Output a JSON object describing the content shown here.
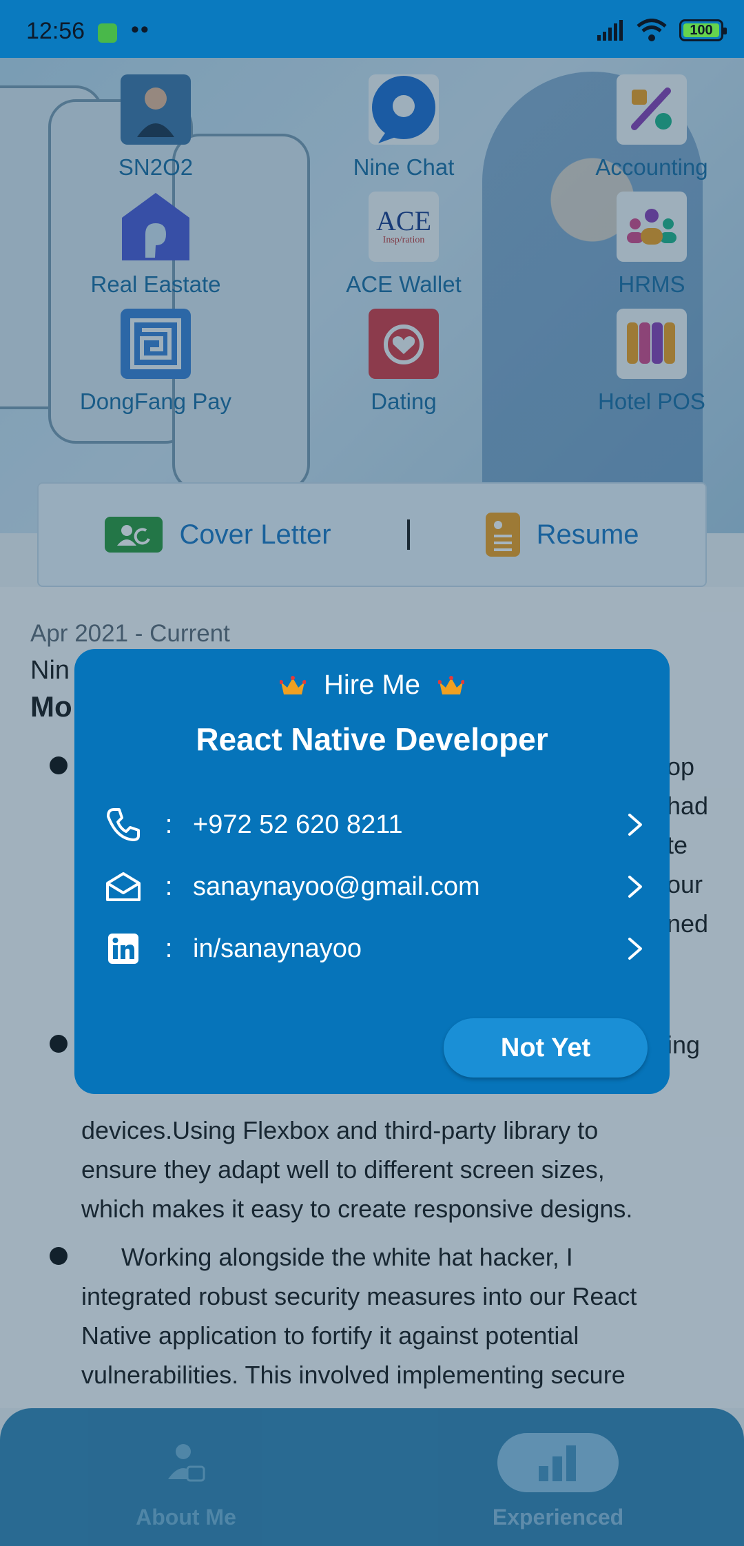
{
  "status_bar": {
    "time": "12:56",
    "battery": "100"
  },
  "apps": [
    {
      "label": "SN2O2",
      "icon": "person-photo-icon",
      "color": "#3f77a8"
    },
    {
      "label": "Nine Chat",
      "icon": "chat-bubble-icon",
      "color": "#1f6fd1"
    },
    {
      "label": "Accounting",
      "icon": "percent-shapes-icon",
      "color": "#f3f5f7"
    },
    {
      "label": "Real Eastate",
      "icon": "house-icon",
      "color": "#4d5bd6"
    },
    {
      "label": "ACE Wallet",
      "icon": "ace-logo-icon",
      "color": "#f3f5f7",
      "logo_text": "ACE",
      "logo_sub": "Insp/ration"
    },
    {
      "label": "HRMS",
      "icon": "people-group-icon",
      "color": "#f3f5f7"
    },
    {
      "label": "DongFang Pay",
      "icon": "pattern-logo-icon",
      "color": "#3b82d6"
    },
    {
      "label": "Dating",
      "icon": "heart-swirl-icon",
      "color": "#d63a45"
    },
    {
      "label": "Hotel POS",
      "icon": "awning-icon",
      "color": "#f3f5f7"
    }
  ],
  "docs": {
    "cover_letter": "Cover Letter",
    "resume": "Resume"
  },
  "experience": {
    "date": "Apr 2021 - Current",
    "company": "Nin",
    "role": "Mo",
    "p1_tail": [
      "op",
      "had",
      "te",
      "our",
      "ned"
    ],
    "p2_tail": "ing",
    "p2_lines": [
      "devices.Using Flexbox and third-party library to",
      "ensure they adapt well to different screen sizes,",
      "which makes it easy to create responsive designs."
    ],
    "p3_lines": [
      "Working alongside the white hat hacker, I",
      "integrated robust security measures into our React",
      "Native application to fortify it against potential",
      "vulnerabilities. This involved implementing secure"
    ]
  },
  "modal": {
    "title": "Hire Me",
    "subtitle": "React Native Developer",
    "contacts": [
      {
        "icon": "phone-icon",
        "value": "+972 52 620 8211"
      },
      {
        "icon": "mail-icon",
        "value": "sanaynayoo@gmail.com"
      },
      {
        "icon": "linkedin-icon",
        "value": "in/sanaynayoo"
      }
    ],
    "colon": ":",
    "button": "Not Yet"
  },
  "nav": {
    "about": "About Me",
    "experienced": "Experienced"
  }
}
